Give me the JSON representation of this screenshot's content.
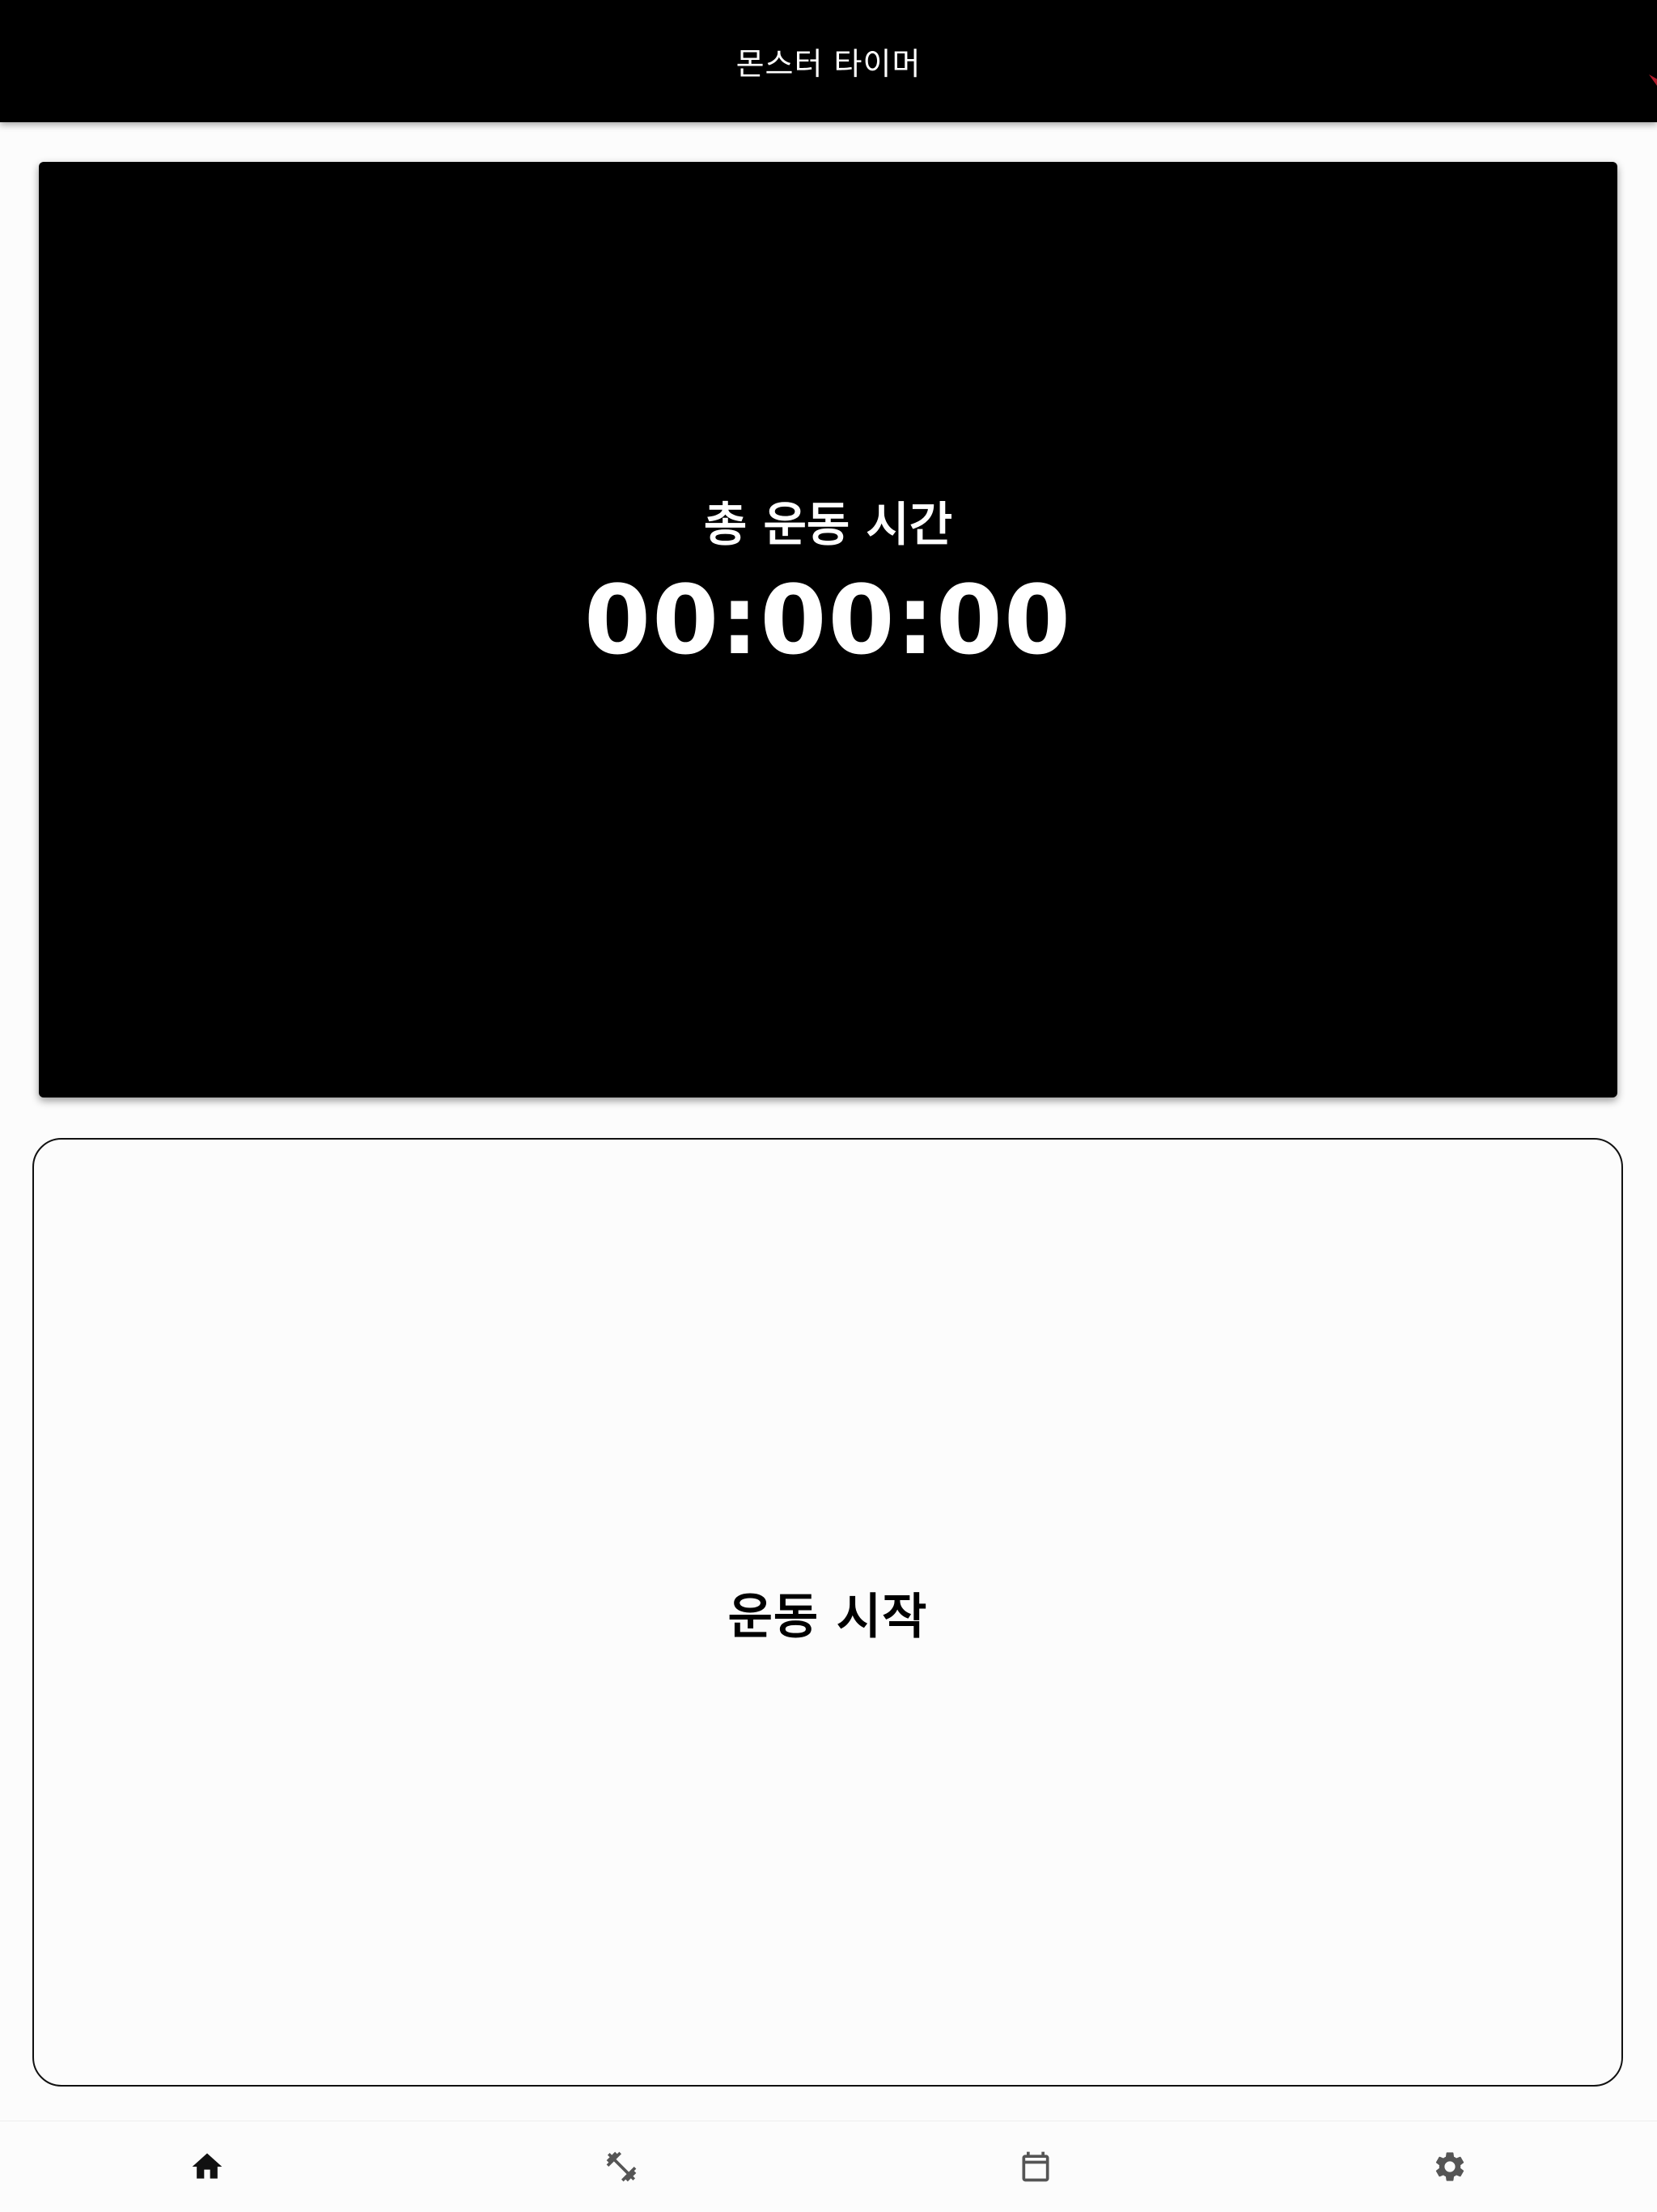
{
  "appbar": {
    "title": "몬스터 타이머",
    "background": "#000000",
    "accent": "#b01c2b"
  },
  "timer": {
    "label": "총 운동 시간",
    "value": "00:00:00"
  },
  "start_button": {
    "label": "운동 시작"
  },
  "bottom_nav": {
    "items": [
      {
        "icon": "home-icon",
        "active": true,
        "color": "#111111"
      },
      {
        "icon": "dumbbell-icon",
        "active": false,
        "color": "#555555"
      },
      {
        "icon": "calendar-icon",
        "active": false,
        "color": "#555555"
      },
      {
        "icon": "gear-icon",
        "active": false,
        "color": "#555555"
      }
    ]
  }
}
